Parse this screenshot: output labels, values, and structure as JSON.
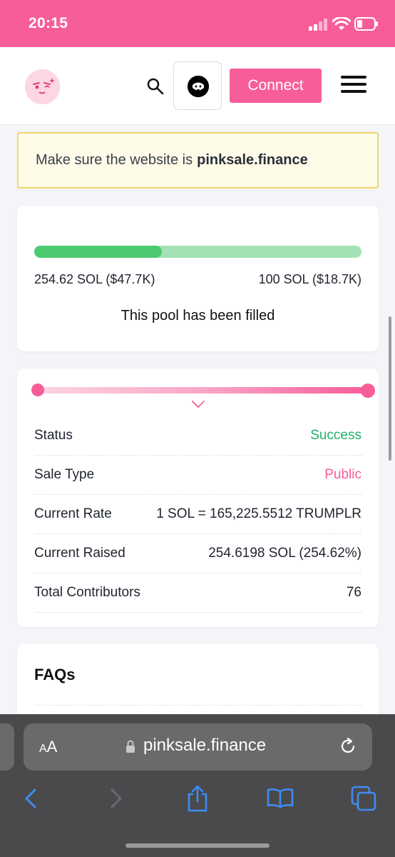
{
  "status_bar": {
    "time": "20:15"
  },
  "header": {
    "connect_label": "Connect"
  },
  "warning": {
    "prefix": "Make sure the website is",
    "domain": "pinksale.finance"
  },
  "progress": {
    "fill_fraction": 0.39,
    "raised_label": "254.62 SOL ($47.7K)",
    "target_label": "100 SOL ($18.7K)",
    "status_text": "This pool has been filled"
  },
  "info": {
    "rows": [
      {
        "label": "Status",
        "value": "Success"
      },
      {
        "label": "Sale Type",
        "value": "Public"
      },
      {
        "label": "Current Rate",
        "value": "1 SOL = 165,225.5512 TRUMPLR"
      },
      {
        "label": "Current Raised",
        "value": "254.6198 SOL (254.62%)"
      },
      {
        "label": "Total Contributors",
        "value": "76"
      }
    ]
  },
  "faq": {
    "title": "FAQs"
  },
  "browser": {
    "aa_label_small": "A",
    "aa_label_big": "A",
    "url": "pinksale.finance"
  },
  "colors": {
    "accent": "#f75d99",
    "success": "#20b36a",
    "progress_fill": "#4cc971",
    "progress_track": "#a4e2b6"
  }
}
